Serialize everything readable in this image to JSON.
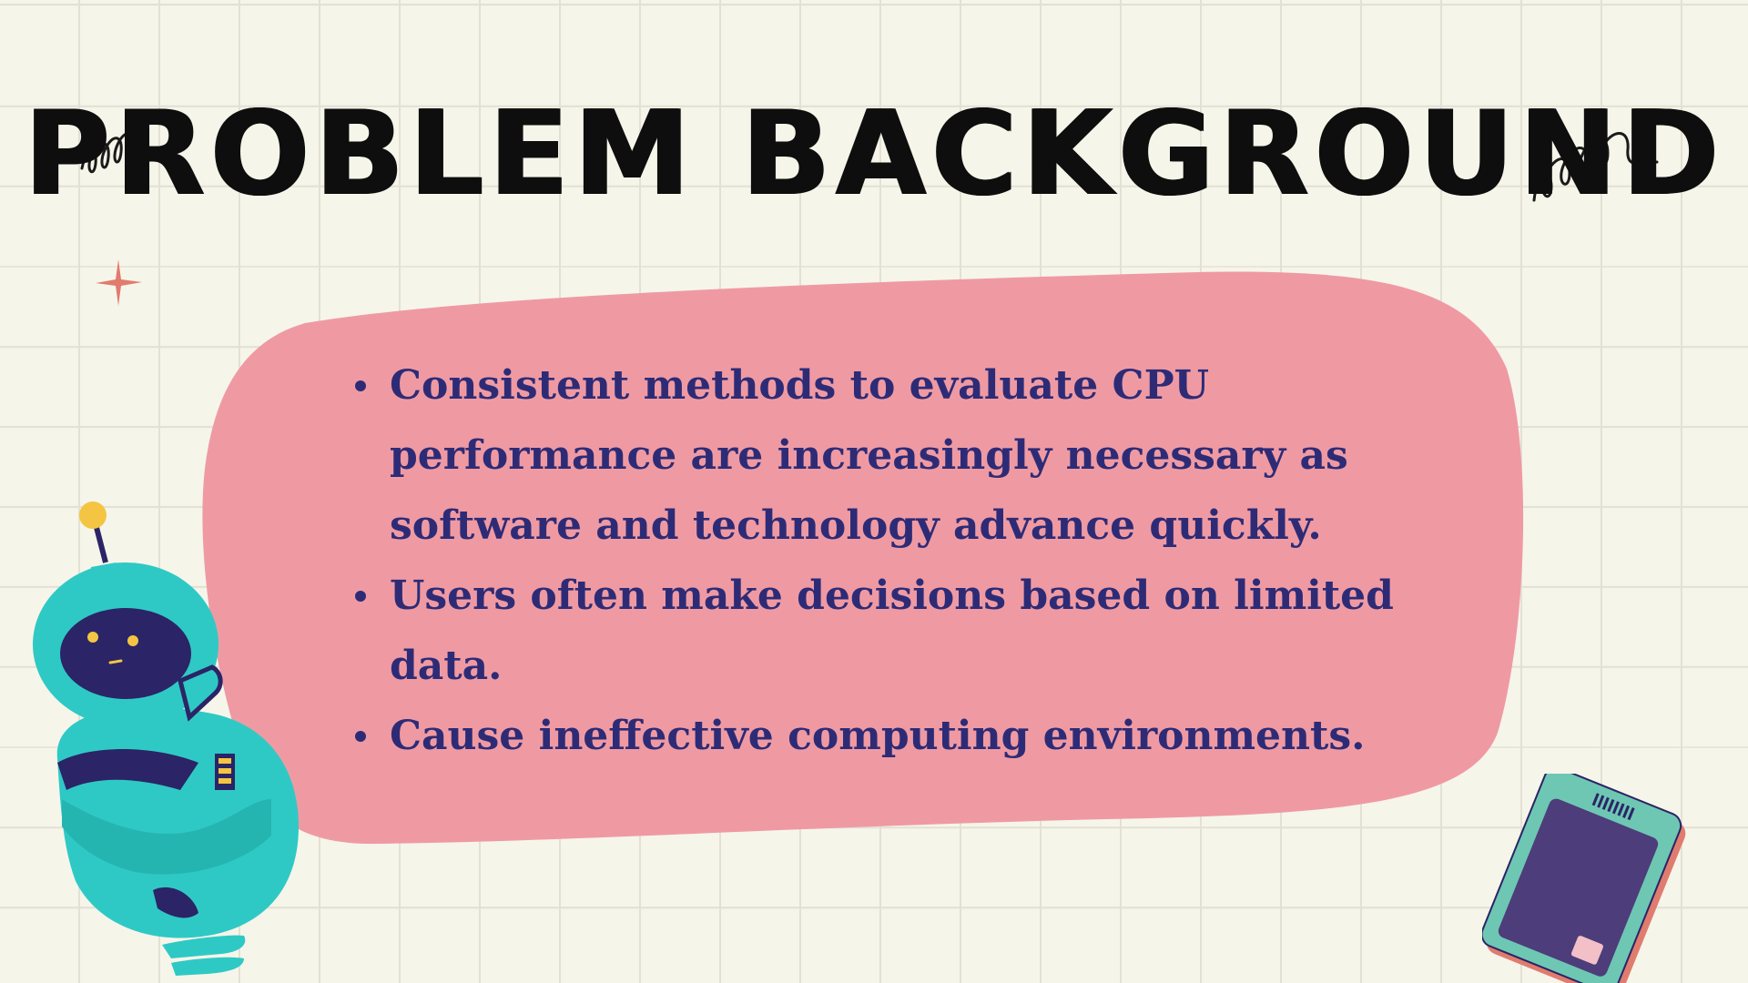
{
  "slide": {
    "title": "PROBLEM BACKGROUND",
    "bullets": [
      "Consistent methods to evaluate CPU performance are increasingly necessary as software and technology advance quickly.",
      "Users often make decisions based on limited data.",
      "Cause ineffective computing environments."
    ]
  },
  "decorations": {
    "left_squiggle": "squiggle-icon",
    "right_squiggle": "squiggle-icon",
    "star": "star-icon",
    "robot": "robot-illustration",
    "ssd": "ssd-illustration"
  },
  "colors": {
    "background": "#f6f5ea",
    "grid": "#e3e1d3",
    "title": "#0e0e0e",
    "blob": "#ef9aa3",
    "bullet_text": "#2e2b76",
    "star": "#e07c6e",
    "robot_body": "#2fc9c5",
    "robot_dark": "#2b2466",
    "robot_accent": "#f4c542",
    "ssd_case": "#6ec7b3",
    "ssd_face": "#4d3d7a"
  }
}
